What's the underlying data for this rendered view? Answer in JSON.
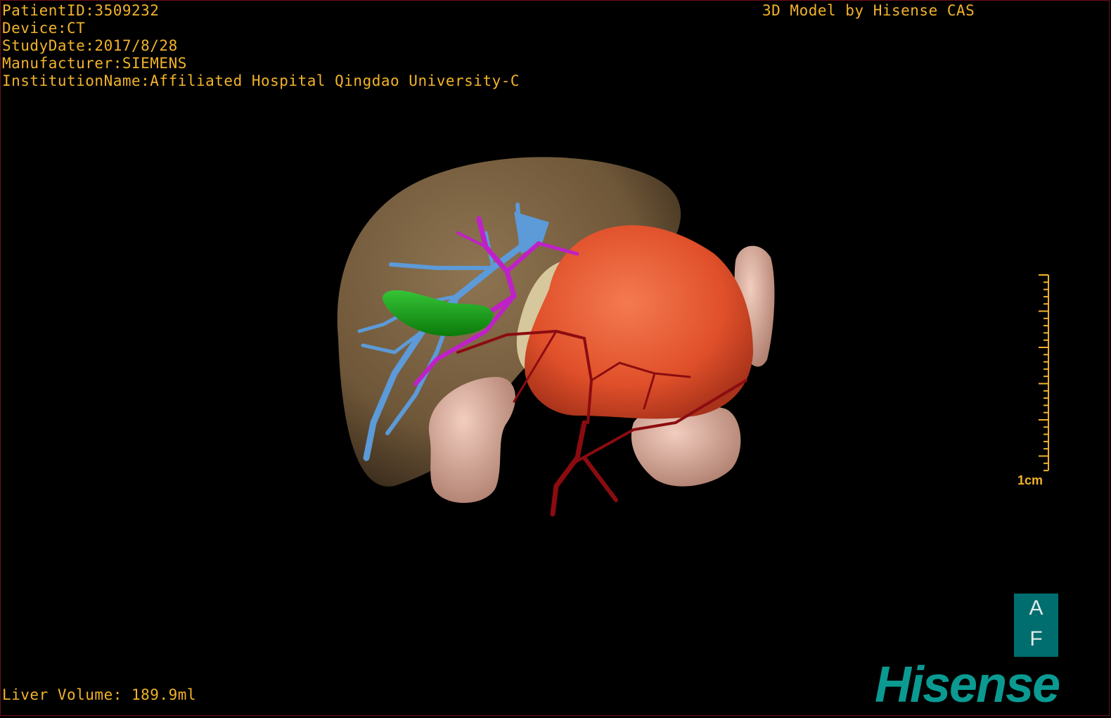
{
  "header": {
    "patient_id": "PatientID:3509232",
    "device": "Device:CT",
    "study_date": "StudyDate:2017/8/28",
    "manufacturer": "Manufacturer:SIEMENS",
    "institution": "InstitutionName:Affiliated Hospital Qingdao University-C"
  },
  "title": "3D Model by Hisense CAS",
  "footer": {
    "liver_volume": "Liver Volume: 189.9ml"
  },
  "scale": {
    "label": "1cm"
  },
  "orientation": {
    "top": "A",
    "bottom": "F"
  },
  "logo": {
    "text": "Hisense"
  },
  "colors": {
    "text": "#f2b32a",
    "liver": "#7f6646",
    "portal_vein": "#5c9ad8",
    "bile_duct": "#c020c8",
    "gallbladder": "#1aa01a",
    "tumor": "#e8532d",
    "artery": "#8b0c10",
    "intestine": "#e6b3a1",
    "pancreas": "#d7c79c",
    "brand": "#0b9a92"
  }
}
